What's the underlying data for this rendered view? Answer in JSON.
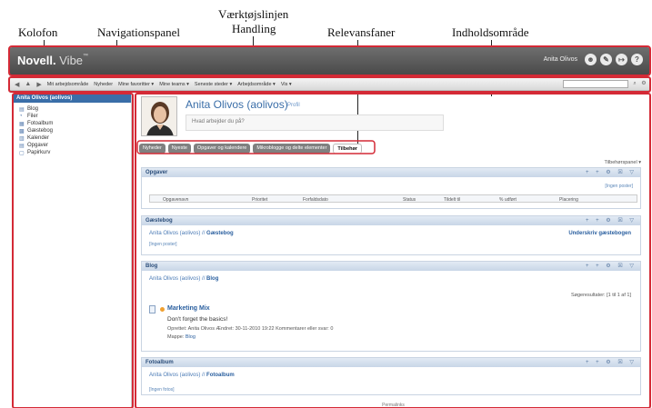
{
  "callouts": {
    "kolofon": "Kolofon",
    "navigationspanel": "Navigationspanel",
    "vaerktoejslinjen": "Værktøjslinjen",
    "handling": "Handling",
    "relevansfaner": "Relevansfaner",
    "indholdsomraade": "Indholdsområde"
  },
  "header": {
    "brand": "Novell.",
    "product": "Vibe",
    "tm": "™",
    "user_name": "Anita Olivos",
    "icons": [
      "person-icon",
      "edit-icon",
      "logout-icon",
      "help-icon"
    ],
    "icon_glyphs": {
      "person": "☻",
      "edit": "✎",
      "logout": "↦",
      "help": "?"
    }
  },
  "toolbar": {
    "items": [
      "Mit arbejdsområde",
      "Nyheder",
      "Mine favoritter ▾",
      "Mine teams ▾",
      "Seneste steder ▾",
      "Arbejdsområde ▾",
      "Vis ▾"
    ]
  },
  "nav": {
    "title": "Anita Olivos (aolivos)",
    "items": [
      {
        "label": "Blog",
        "icon": "blog-icon",
        "glyph": "▤"
      },
      {
        "label": "Filer",
        "icon": "files-icon",
        "glyph": "◔"
      },
      {
        "label": "Fotoalbum",
        "icon": "photo-album-icon",
        "glyph": "▦"
      },
      {
        "label": "Gæstebog",
        "icon": "guestbook-icon",
        "glyph": "▩"
      },
      {
        "label": "Kalender",
        "icon": "calendar-icon",
        "glyph": "▥"
      },
      {
        "label": "Opgaver",
        "icon": "tasks-icon",
        "glyph": "▤"
      },
      {
        "label": "Papirkurv",
        "icon": "trash-icon",
        "glyph": "▢"
      }
    ]
  },
  "profile": {
    "name": "Anita Olivos (aolivos)",
    "profile_link": "Profil",
    "status_placeholder": "Hvad arbejder du på?"
  },
  "tabs": [
    "Nyheder",
    "Nyeste",
    "Opgaver og kalendere",
    "Mikroblogge og delte elementer",
    "Tilbehør"
  ],
  "tile_panel_label": "Tilbehørspanel ▾",
  "sections": {
    "tasks": {
      "title": "Opgaver",
      "no_posts": "[Ingen poster]",
      "columns": [
        "Opgavenavn",
        "Prioritet",
        "Forfaldsdato",
        "Status",
        "Tildelt til",
        "% udført",
        "Placering"
      ]
    },
    "guestbook": {
      "title": "Gæstebog",
      "crumb_owner": "Anita Olivos (aolivos)",
      "crumb_sep": " // ",
      "crumb_target": "Gæstebog",
      "sign_link": "Underskriv gæstebogen",
      "no_posts": "[Ingen poster]"
    },
    "blog": {
      "title": "Blog",
      "crumb_owner": "Anita Olivos (aolivos)",
      "crumb_sep": " // ",
      "crumb_target": "Blog",
      "search_result": "Søgeresultater: [1 til 1 af 1]",
      "post_title": "Marketing Mix",
      "post_body": "Don't forget the basics!",
      "post_meta": "Oprettet: Anita Olivos   Ændret: 30-11-2010 19:22   Kommentarer eller svar: 0",
      "post_folder_label": "Mappe:",
      "post_folder": "Blog"
    },
    "photo": {
      "title": "Fotoalbum",
      "crumb_owner": "Anita Olivos (aolivos)",
      "crumb_sep": " // ",
      "crumb_target": "Fotoalbum",
      "no_photos": "[Ingen fotos]"
    }
  },
  "section_controls": "+ + ⚙ ☒ ▽",
  "permalink": "Permalinks",
  "colors": {
    "header_bg": "#4a4a4a",
    "nav_title_bg": "#3a6ea8",
    "section_header_bg": "#c8d6e7",
    "frame_red": "#d42a36",
    "link_blue": "#2a5f9f"
  }
}
